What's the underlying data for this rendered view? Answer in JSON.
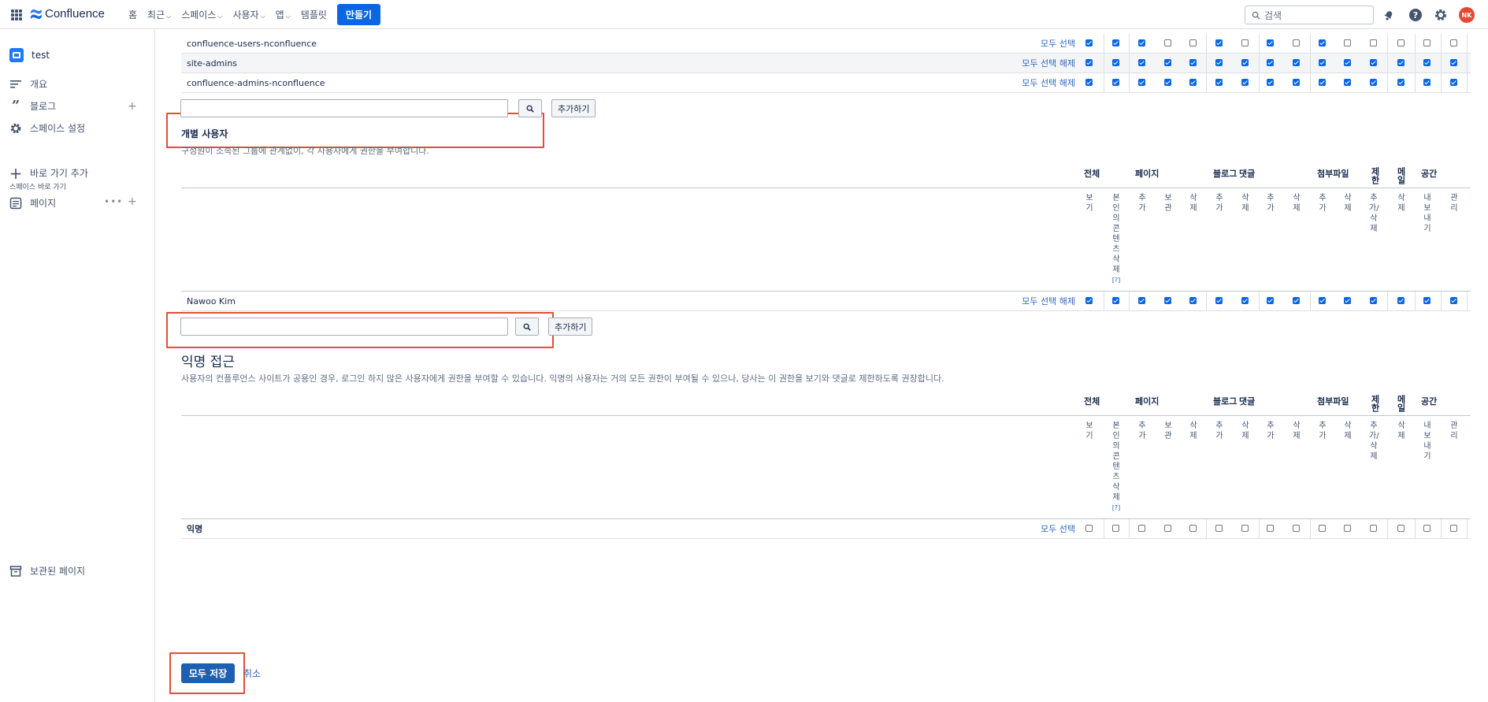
{
  "topbar": {
    "logo": "Confluence",
    "nav": [
      "홈",
      "최근",
      "스페이스",
      "사용자",
      "앱",
      "템플릿"
    ],
    "nav_has_chevron": [
      false,
      true,
      true,
      true,
      true,
      false
    ],
    "create_label": "만들기",
    "search_placeholder": "검색",
    "avatar_initials": "NK"
  },
  "sidebar": {
    "space_name": "test",
    "overview": "개요",
    "blog": "블로그",
    "space_settings": "스페이스 설정",
    "shortcuts_header": "스페이스 바로 가기",
    "add_shortcut": "바로 가기 추가",
    "pages": "페이지",
    "archived": "보관된 페이지"
  },
  "groups": [
    {
      "name": "confluence-users-nconfluence",
      "link": "모두 선택",
      "checks": [
        1,
        1,
        1,
        0,
        0,
        1,
        0,
        1,
        0,
        1,
        0,
        0,
        0,
        0,
        0
      ]
    },
    {
      "name": "site-admins",
      "link": "모두 선택 해제",
      "checks": [
        1,
        1,
        1,
        1,
        1,
        1,
        1,
        1,
        1,
        1,
        1,
        1,
        1,
        1,
        1
      ]
    },
    {
      "name": "confluence-admins-nconfluence",
      "link": "모두 선택 해제",
      "checks": [
        1,
        1,
        1,
        1,
        1,
        1,
        1,
        1,
        1,
        1,
        1,
        1,
        1,
        1,
        1
      ]
    }
  ],
  "add_button": "추가하기",
  "individual": {
    "title": "개별 사용자",
    "desc": "구성원이 소속된 그룹에 관계없이, 각 사용자에게 권한을 부여합니다.",
    "users": [
      {
        "name": "Nawoo Kim",
        "link": "모두 선택 해제",
        "checks": [
          1,
          1,
          1,
          1,
          1,
          1,
          1,
          1,
          1,
          1,
          1,
          1,
          1,
          1,
          1
        ]
      }
    ]
  },
  "anonymous": {
    "title": "익명 접근",
    "desc": "사용자의 컨플루언스 사이트가 공용인 경우, 로그인 하지 않은 사용자에게 권한을 부여할 수 있습니다. 익명의 사용자는 거의 모든 권한이 부여될 수 있으나, 당사는 이 권한을 보기와 댓글로 제한하도록 권장합니다.",
    "row_name": "익명",
    "link": "모두 선택",
    "checks": [
      0,
      0,
      0,
      0,
      0,
      0,
      0,
      0,
      0,
      0,
      0,
      0,
      0,
      0,
      0
    ]
  },
  "categories": [
    "전체",
    "페이지",
    "블로그",
    "댓글",
    "첨부파일",
    "제한",
    "메일",
    "공간"
  ],
  "permissions": [
    "보기",
    "본인의콘텐츠삭제",
    "추가",
    "보관",
    "삭제",
    "추가",
    "삭제",
    "추가",
    "삭제",
    "추가",
    "삭제",
    "추가/삭제",
    "삭제",
    "내보내기",
    "관리"
  ],
  "help_mark": "[?]",
  "save_label": "모두 저장",
  "cancel_label": "취소"
}
